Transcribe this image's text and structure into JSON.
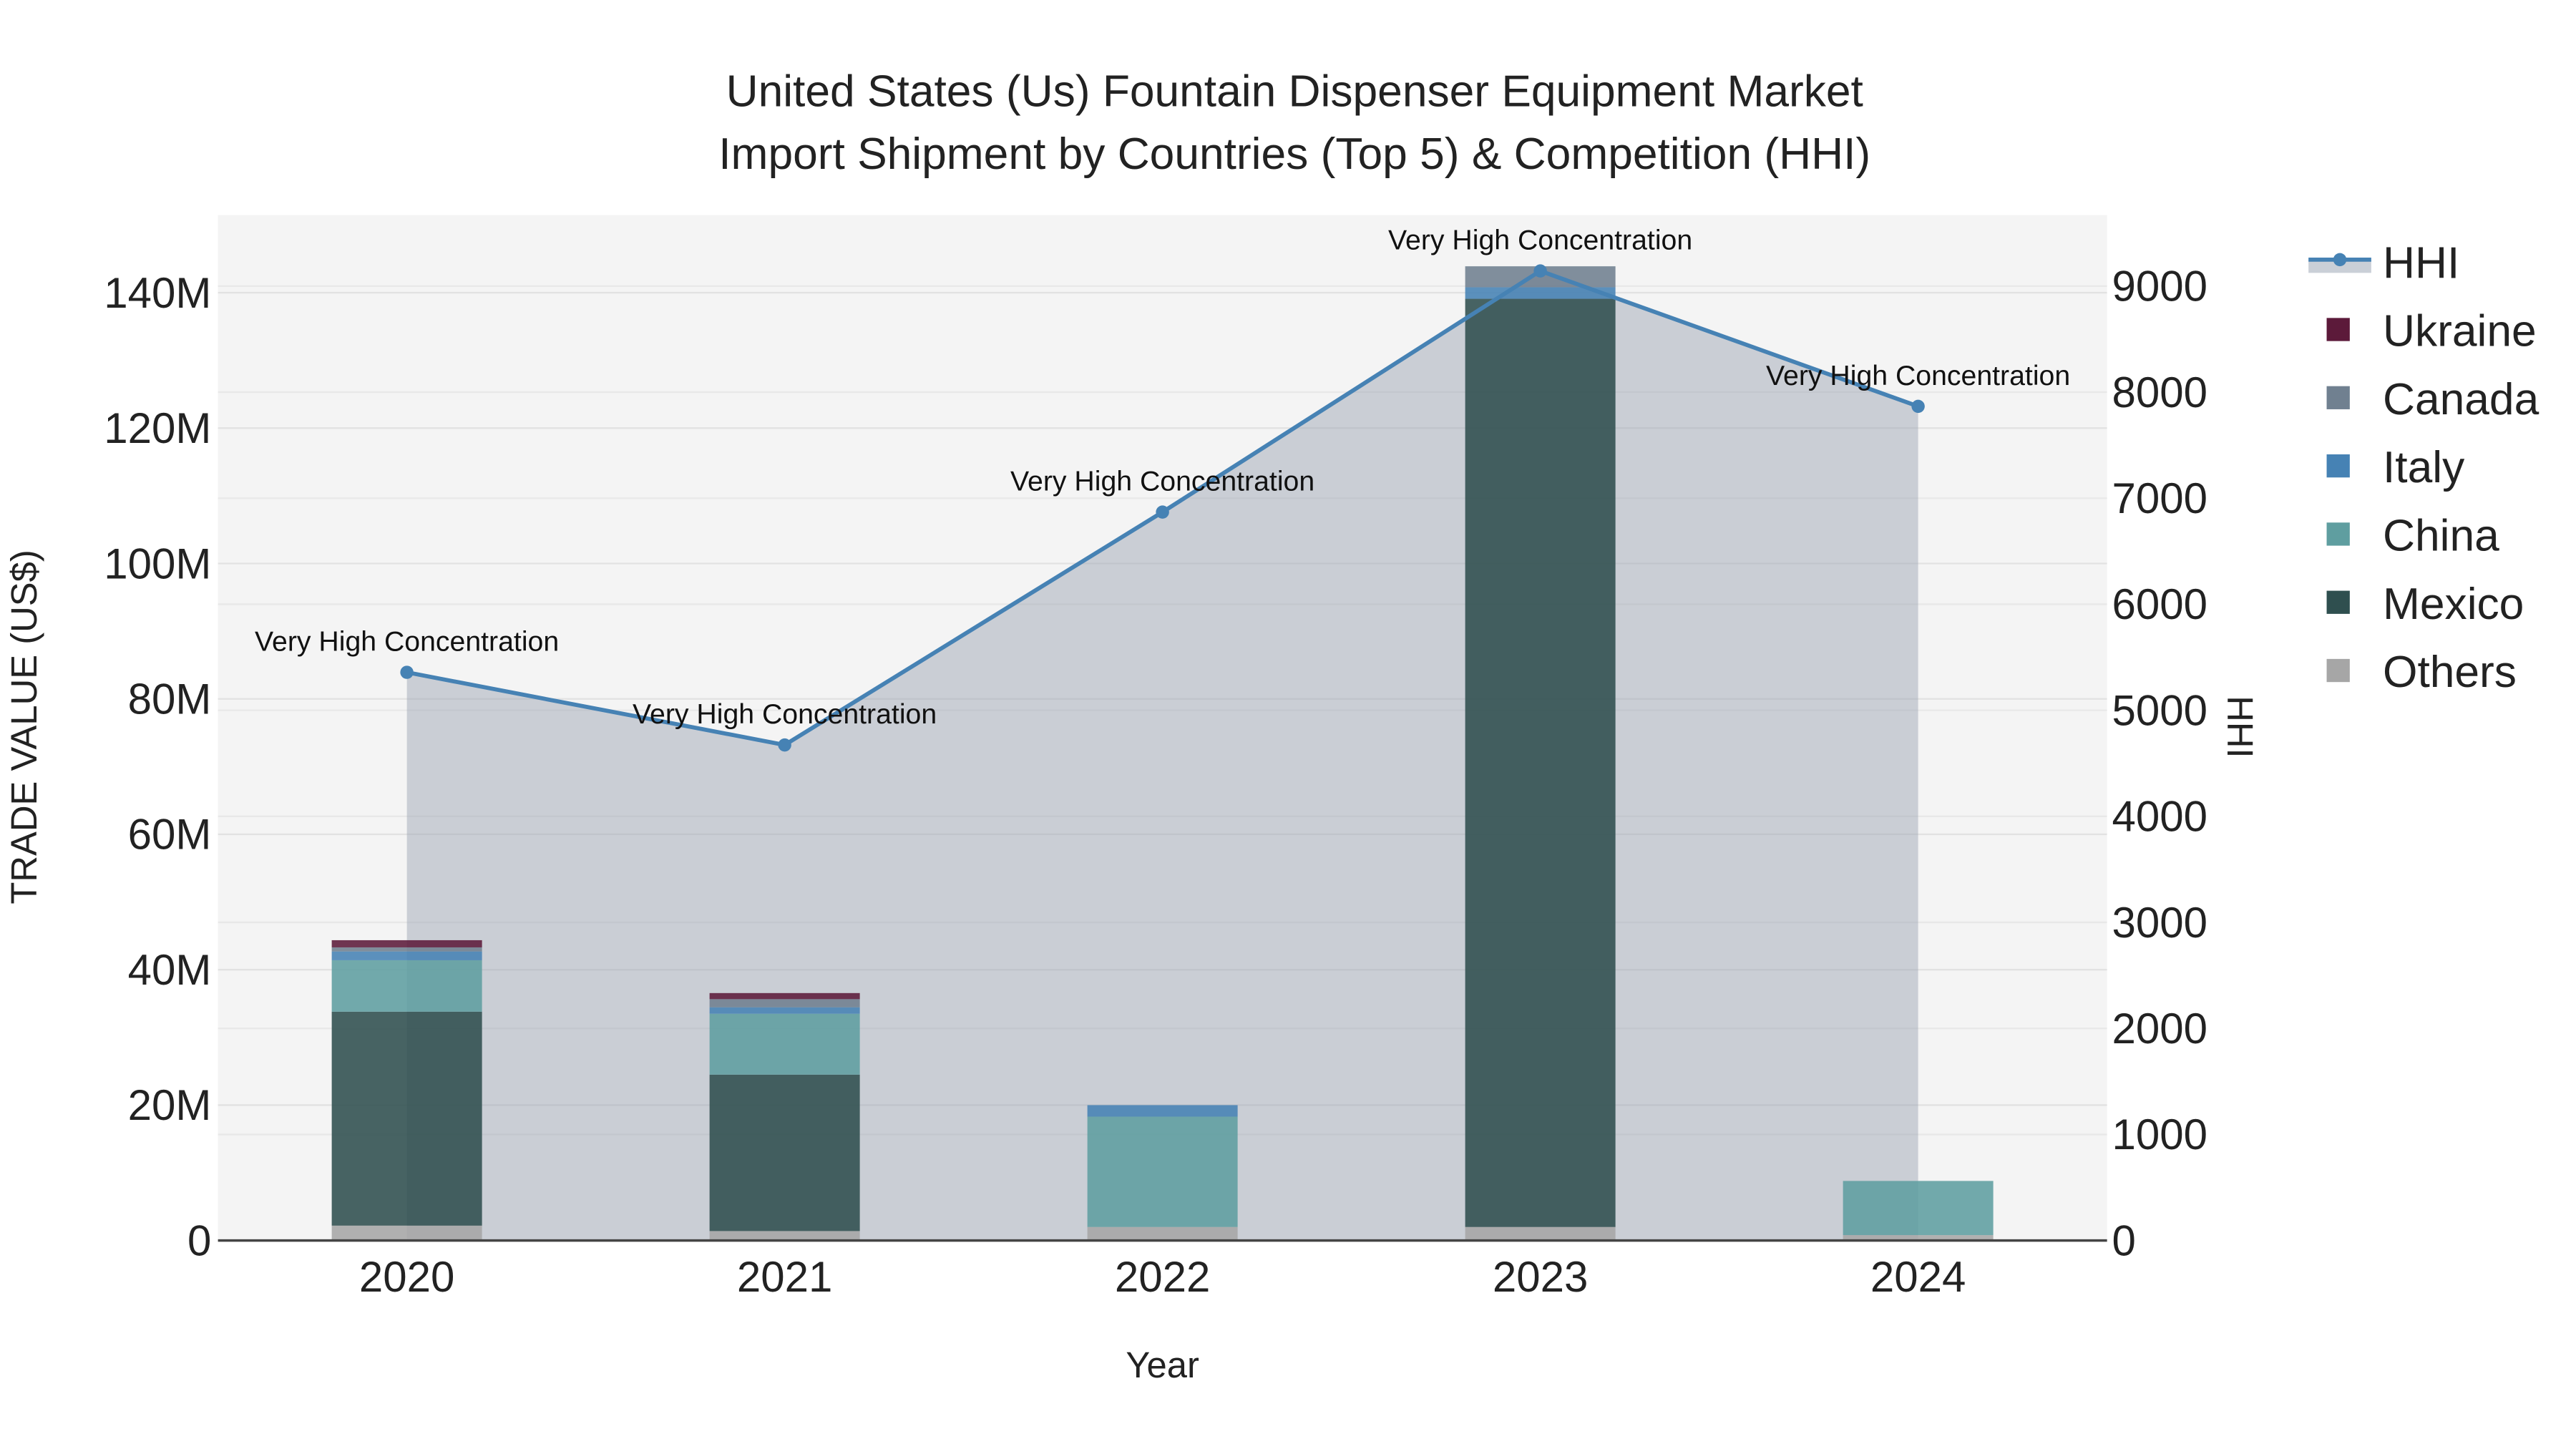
{
  "chart_data": {
    "type": "bar",
    "title_line1": "United States (Us) Fountain Dispenser Equipment Market",
    "title_line2": "Import Shipment by Countries (Top 5) & Competition (HHI)",
    "xlabel": "Year",
    "ylabel": "TRADE VALUE (US$)",
    "y2label": "HHI",
    "categories": [
      "2020",
      "2021",
      "2022",
      "2023",
      "2024"
    ],
    "ylim": [
      0,
      150
    ],
    "y_unit": "M",
    "yticks": [
      0,
      20,
      40,
      60,
      80,
      100,
      120,
      140
    ],
    "ytick_labels": [
      "0",
      "20M",
      "40M",
      "60M",
      "80M",
      "100M",
      "120M",
      "140M"
    ],
    "y2lim": [
      0,
      9700
    ],
    "y2ticks": [
      0,
      1000,
      2000,
      3000,
      4000,
      5000,
      6000,
      7000,
      8000,
      9000
    ],
    "y2tick_labels": [
      "0",
      "1000",
      "2000",
      "3000",
      "4000",
      "5000",
      "6000",
      "7000",
      "8000",
      "9000"
    ],
    "series": [
      {
        "name": "Others",
        "color": "#a6a6a6",
        "values": [
          2.2,
          1.4,
          2.0,
          2.0,
          0.8
        ]
      },
      {
        "name": "Mexico",
        "color": "#2f4f4f",
        "values": [
          31.6,
          23.1,
          0,
          137.1,
          0
        ]
      },
      {
        "name": "China",
        "color": "#5f9ea0",
        "values": [
          7.6,
          9.0,
          16.3,
          0,
          8.0
        ]
      },
      {
        "name": "Italy",
        "color": "#4682b4",
        "values": [
          1.3,
          0.95,
          1.7,
          1.7,
          0
        ]
      },
      {
        "name": "Canada",
        "color": "#708090",
        "values": [
          0.6,
          1.2,
          0,
          3.1,
          0
        ]
      },
      {
        "name": "Ukraine",
        "color": "#5c1a3a",
        "values": [
          1.06,
          0.9,
          0,
          0,
          0
        ]
      }
    ],
    "hhi": {
      "name": "HHI",
      "color": "#4682b4",
      "values": [
        5358,
        4673,
        6869,
        9143,
        7866
      ],
      "annotations": [
        "Very High Concentration",
        "Very High Concentration",
        "Very High Concentration",
        "Very High Concentration",
        "Very High Concentration"
      ]
    },
    "legend_order": [
      "HHI",
      "Ukraine",
      "Canada",
      "Italy",
      "China",
      "Mexico",
      "Others"
    ],
    "legend_placement": "right",
    "grid": true
  }
}
